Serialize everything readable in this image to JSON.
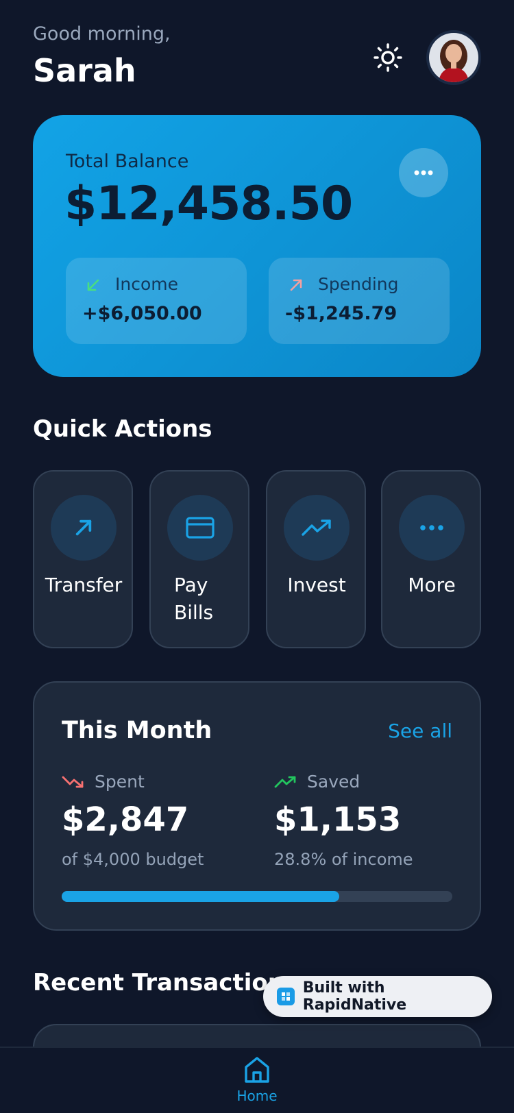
{
  "header": {
    "greeting": "Good morning,",
    "name": "Sarah"
  },
  "balance_card": {
    "label": "Total Balance",
    "amount": "$12,458.50",
    "income": {
      "label": "Income",
      "value": "+$6,050.00"
    },
    "spending": {
      "label": "Spending",
      "value": "-$1,245.79"
    }
  },
  "quick_actions": {
    "title": "Quick Actions",
    "items": [
      {
        "label": "Transfer",
        "icon": "arrow-up-right-icon"
      },
      {
        "label": "Pay Bills",
        "icon": "credit-card-icon"
      },
      {
        "label": "Invest",
        "icon": "trending-up-icon"
      },
      {
        "label": "More",
        "icon": "more-dots-icon"
      }
    ]
  },
  "this_month": {
    "title": "This Month",
    "see_all": "See all",
    "spent": {
      "label": "Spent",
      "value": "$2,847",
      "sub": "of $4,000 budget"
    },
    "saved": {
      "label": "Saved",
      "value": "$1,153",
      "sub": "28.8% of income"
    },
    "budget_progress": 0.71
  },
  "recent_transactions": {
    "title": "Recent Transactions"
  },
  "badge": {
    "text": "Built with RapidNative"
  },
  "bottom_nav": {
    "home_label": "Home"
  },
  "colors": {
    "background": "#0f172a",
    "card": "#1e293b",
    "accent": "#1aa3e6",
    "income_green": "#4ade80",
    "spending_pink": "#f4a0a0",
    "spent_red": "#f87171",
    "saved_green": "#22c55e"
  }
}
